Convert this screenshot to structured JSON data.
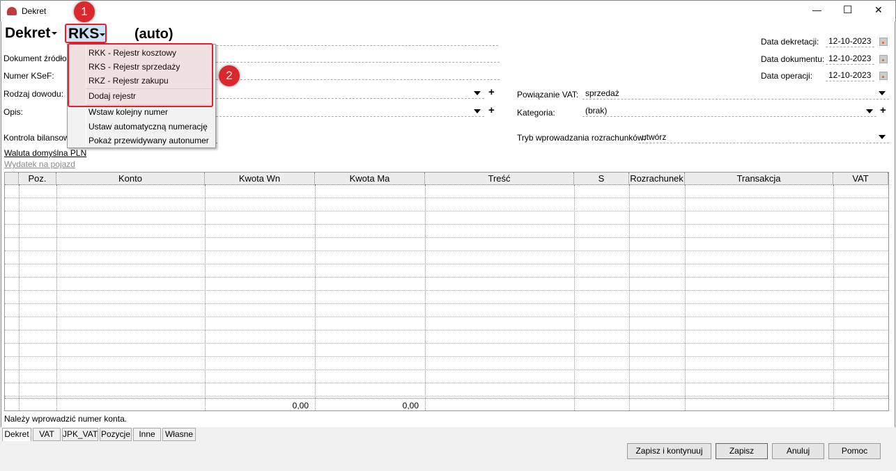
{
  "window": {
    "title": "Dekret",
    "minimize": "—",
    "maximize": "☐",
    "close": "✕"
  },
  "header": {
    "doc_type": "Dekret",
    "register": "RKS",
    "number": "(auto)"
  },
  "left_fields": {
    "source_doc": "Dokument źródłowy:",
    "ksef": "Numer KSeF:",
    "proof_type": "Rodzaj dowodu:",
    "description": "Opis:",
    "balance_control": "Kontrola bilansowania:",
    "currency_link": "Waluta domyślna PLN",
    "vehicle_link": "Wydatek na pojazd"
  },
  "dates": [
    {
      "label": "Data dekretacji:",
      "value": "12-10-2023"
    },
    {
      "label": "Data dokumentu:",
      "value": "12-10-2023"
    },
    {
      "label": "Data operacji:",
      "value": "12-10-2023"
    }
  ],
  "right_fields": {
    "vat_link_label": "Powiązanie VAT:",
    "vat_link_value": "sprzedaż",
    "category_label": "Kategoria:",
    "category_value": "(brak)",
    "settlement_label": "Tryb wprowadzania rozrachunków:",
    "settlement_value": "utwórz"
  },
  "menu": {
    "items": [
      "RKK - Rejestr kosztowy",
      "RKS - Rejestr sprzedaży",
      "RKZ - Rejestr zakupu",
      "Dodaj rejestr",
      "Wstaw kolejny numer",
      "Ustaw automatyczną numerację",
      "Pokaż przewidywany autonumer"
    ]
  },
  "annotations": {
    "badge1": "1",
    "badge2": "2"
  },
  "grid": {
    "columns": [
      "",
      "Poz.",
      "Konto",
      "Kwota Wn",
      "Kwota Ma",
      "Treść",
      "S",
      "Rozrachunek",
      "Transakcja",
      "VAT"
    ],
    "totals": {
      "wn": "0,00",
      "ma": "0,00"
    }
  },
  "status": "Należy wprowadzić numer konta.",
  "tabs": [
    "Dekret",
    "VAT",
    "JPK_VAT",
    "Pozycje",
    "Inne",
    "Własne"
  ],
  "buttons": {
    "save_continue": "Zapisz i kontynuuj",
    "save": "Zapisz",
    "cancel": "Anuluj",
    "help": "Pomoc"
  }
}
